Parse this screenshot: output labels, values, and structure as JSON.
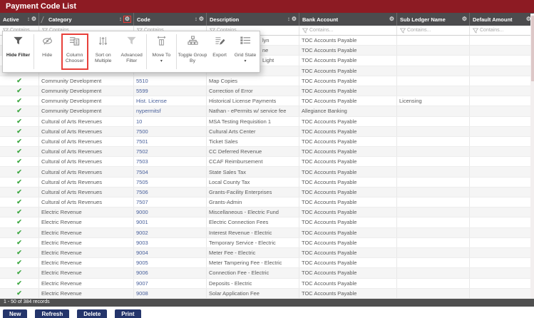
{
  "title": "Payment Code List",
  "grid": {
    "columns": [
      {
        "label": "Active",
        "sortable": true,
        "gear": true,
        "gear_highlighted": false
      },
      {
        "label": "Category",
        "sortable": true,
        "gear": true,
        "gear_highlighted": true
      },
      {
        "label": "Code",
        "sortable": true,
        "gear": true,
        "gear_highlighted": false
      },
      {
        "label": "Description",
        "sortable": true,
        "gear": true,
        "gear_highlighted": false
      },
      {
        "label": "Bank Account",
        "sortable": false,
        "gear": true,
        "gear_highlighted": false
      },
      {
        "label": "Sub Ledger Name",
        "sortable": false,
        "gear": true,
        "gear_highlighted": false
      },
      {
        "label": "Default Amount",
        "sortable": false,
        "gear": true,
        "gear_highlighted": false
      }
    ],
    "filter_placeholder": "Contains...",
    "rows": [
      {
        "active": false,
        "category": "",
        "code": "",
        "description": "lyn",
        "bank_account": "TOC Accounts Payable",
        "sub_ledger": "",
        "default_amount": "",
        "partial": true
      },
      {
        "active": false,
        "category": "",
        "code": "",
        "description": "ne",
        "bank_account": "TOC Accounts Payable",
        "sub_ledger": "",
        "default_amount": "",
        "partial": true
      },
      {
        "active": false,
        "category": "",
        "code": "",
        "description": "Light",
        "bank_account": "TOC Accounts Payable",
        "sub_ledger": "",
        "default_amount": "",
        "partial": true
      },
      {
        "active": false,
        "category": "",
        "code": "",
        "description": "",
        "bank_account": "TOC Accounts Payable",
        "sub_ledger": "",
        "default_amount": "",
        "partial": true
      },
      {
        "active": true,
        "category": "Community Development",
        "code": "5510",
        "description": "Map Copies",
        "bank_account": "TOC Accounts Payable",
        "sub_ledger": "",
        "default_amount": "",
        "partial": false
      },
      {
        "active": true,
        "category": "Community Development",
        "code": "5599",
        "description": "Correction of Error",
        "bank_account": "TOC Accounts Payable",
        "sub_ledger": "",
        "default_amount": "",
        "partial": false
      },
      {
        "active": true,
        "category": "Community Development",
        "code": "Hist. License",
        "description": "Historical License Payments",
        "bank_account": "TOC Accounts Payable",
        "sub_ledger": "Licensing",
        "default_amount": "",
        "partial": false
      },
      {
        "active": true,
        "category": "Community Development",
        "code": "nypermitsf",
        "description": "Nathan - ePermits w/ service fee",
        "bank_account": "Allegiance Banking",
        "sub_ledger": "",
        "default_amount": "",
        "partial": false
      },
      {
        "active": true,
        "category": "Cultural of Arts Revenues",
        "code": "10",
        "description": "MSA Testing Requisition 1",
        "bank_account": "TOC Accounts Payable",
        "sub_ledger": "",
        "default_amount": "",
        "partial": false
      },
      {
        "active": true,
        "category": "Cultural of Arts Revenues",
        "code": "7500",
        "description": "Cultural Arts Center",
        "bank_account": "TOC Accounts Payable",
        "sub_ledger": "",
        "default_amount": "",
        "partial": false
      },
      {
        "active": true,
        "category": "Cultural of Arts Revenues",
        "code": "7501",
        "description": "Ticket Sales",
        "bank_account": "TOC Accounts Payable",
        "sub_ledger": "",
        "default_amount": "",
        "partial": false
      },
      {
        "active": true,
        "category": "Cultural of Arts Revenues",
        "code": "7502",
        "description": "CC Deferred Revenue",
        "bank_account": "TOC Accounts Payable",
        "sub_ledger": "",
        "default_amount": "",
        "partial": false
      },
      {
        "active": true,
        "category": "Cultural of Arts Revenues",
        "code": "7503",
        "description": "CCAF Reimbursement",
        "bank_account": "TOC Accounts Payable",
        "sub_ledger": "",
        "default_amount": "",
        "partial": false
      },
      {
        "active": true,
        "category": "Cultural of Arts Revenues",
        "code": "7504",
        "description": "State Sales Tax",
        "bank_account": "TOC Accounts Payable",
        "sub_ledger": "",
        "default_amount": "",
        "partial": false
      },
      {
        "active": true,
        "category": "Cultural of Arts Revenues",
        "code": "7505",
        "description": "Local County Tax",
        "bank_account": "TOC Accounts Payable",
        "sub_ledger": "",
        "default_amount": "",
        "partial": false
      },
      {
        "active": true,
        "category": "Cultural of Arts Revenues",
        "code": "7506",
        "description": "Grants-Facility Enterprises",
        "bank_account": "TOC Accounts Payable",
        "sub_ledger": "",
        "default_amount": "",
        "partial": false
      },
      {
        "active": true,
        "category": "Cultural of Arts Revenues",
        "code": "7507",
        "description": "Grants-Admin",
        "bank_account": "TOC Accounts Payable",
        "sub_ledger": "",
        "default_amount": "",
        "partial": false
      },
      {
        "active": true,
        "category": "Electric Revenue",
        "code": "9000",
        "description": "Miscellaneous - Electric Fund",
        "bank_account": "TOC Accounts Payable",
        "sub_ledger": "",
        "default_amount": "",
        "partial": false
      },
      {
        "active": true,
        "category": "Electric Revenue",
        "code": "9001",
        "description": "Electric Connection Fees",
        "bank_account": "TOC Accounts Payable",
        "sub_ledger": "",
        "default_amount": "",
        "partial": false
      },
      {
        "active": true,
        "category": "Electric Revenue",
        "code": "9002",
        "description": "Interest Revenue - Electric",
        "bank_account": "TOC Accounts Payable",
        "sub_ledger": "",
        "default_amount": "",
        "partial": false
      },
      {
        "active": true,
        "category": "Electric Revenue",
        "code": "9003",
        "description": "Temporary Service - Electric",
        "bank_account": "TOC Accounts Payable",
        "sub_ledger": "",
        "default_amount": "",
        "partial": false
      },
      {
        "active": true,
        "category": "Electric Revenue",
        "code": "9004",
        "description": "Meter Fee - Electric",
        "bank_account": "TOC Accounts Payable",
        "sub_ledger": "",
        "default_amount": "",
        "partial": false
      },
      {
        "active": true,
        "category": "Electric Revenue",
        "code": "9005",
        "description": "Meter Tampering Fee - Electric",
        "bank_account": "TOC Accounts Payable",
        "sub_ledger": "",
        "default_amount": "",
        "partial": false
      },
      {
        "active": true,
        "category": "Electric Revenue",
        "code": "9006",
        "description": "Connection Fee - Electric",
        "bank_account": "TOC Accounts Payable",
        "sub_ledger": "",
        "default_amount": "",
        "partial": false
      },
      {
        "active": true,
        "category": "Electric Revenue",
        "code": "9007",
        "description": "Deposits - Electric",
        "bank_account": "TOC Accounts Payable",
        "sub_ledger": "",
        "default_amount": "",
        "partial": false
      },
      {
        "active": true,
        "category": "Electric Revenue",
        "code": "9008",
        "description": "Solar Application Fee",
        "bank_account": "TOC Accounts Payable",
        "sub_ledger": "",
        "default_amount": "",
        "partial": false
      }
    ],
    "footer_text": "1 - 50 of 384 records"
  },
  "toolbar": {
    "items": [
      {
        "label": "Hide Filter",
        "icon": "hide-filter-icon",
        "emphasized": true
      },
      {
        "label": "Hide",
        "icon": "hide-icon"
      },
      {
        "label": "Column Chooser",
        "icon": "column-chooser-icon",
        "highlighted": true
      },
      {
        "label": "Sort on Multiple",
        "icon": "sort-multiple-icon"
      },
      {
        "label": "Advanced Filter",
        "icon": "advanced-filter-icon"
      },
      {
        "label": "Move To",
        "icon": "move-to-icon",
        "caret": true
      },
      {
        "label": "Toggle Group By",
        "icon": "toggle-group-icon"
      },
      {
        "label": "Export",
        "icon": "export-icon"
      },
      {
        "label": "Grid State",
        "icon": "grid-state-icon",
        "caret": true
      }
    ]
  },
  "action_buttons": [
    "New",
    "Refresh",
    "Delete",
    "Print"
  ],
  "colors": {
    "title_bar": "#8d1b23",
    "header_bar": "#4c4c4e",
    "accent_red": "#e8403a",
    "link_blue": "#49609b",
    "check_green": "#3ea843",
    "button_navy": "#24356b",
    "alt_row": "#f5f5f5"
  }
}
